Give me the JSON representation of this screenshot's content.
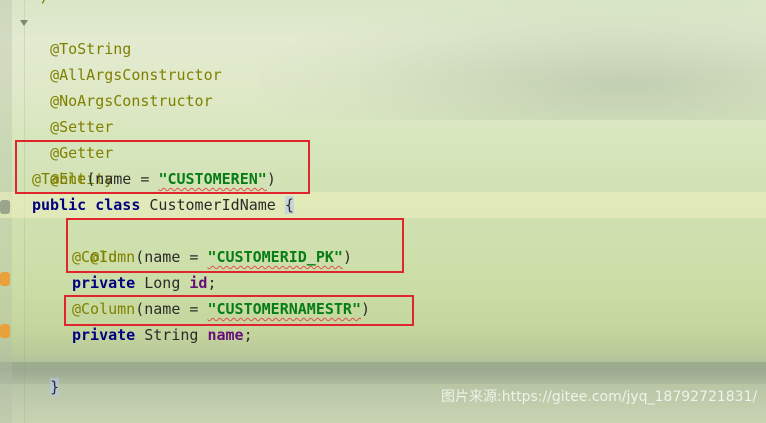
{
  "editor": {
    "top_fragment": "*/",
    "lines": {
      "l1": "@ToString",
      "l2": "@AllArgsConstructor",
      "l3": "@NoArgsConstructor",
      "l4": "@Setter",
      "l5": "@Getter",
      "l6": "@Entity",
      "l7_ann": "@Table",
      "l7_open": "(name = ",
      "l7_str": "\"CUSTOMEREN\"",
      "l7_close": ")",
      "l8_kw1": "public",
      "l8_kw2": "class",
      "l8_name": "CustomerIdName",
      "l8_brace": "{",
      "l9": "@Id",
      "l10_ann": "@Column",
      "l10_open": "(name = ",
      "l10_str": "\"CUSTOMERID_PK\"",
      "l10_close": ")",
      "l11_kw": "private",
      "l11_type": "Long",
      "l11_field": "id",
      "l11_end": ";",
      "l12_ann": "@Column",
      "l12_open": "(name = ",
      "l12_str": "\"CUSTOMERNAMESTR\"",
      "l12_close": ")",
      "l13_kw": "private",
      "l13_type": "String",
      "l13_field": "name",
      "l13_end": ";",
      "l14": "}"
    }
  },
  "watermark": "图片来源:https://gitee.com/jyq_18792721831/",
  "colors": {
    "annotation": "#808000",
    "keyword": "#000080",
    "string": "#067d17",
    "field": "#660e7a",
    "highlight_box": "#e0262c"
  }
}
